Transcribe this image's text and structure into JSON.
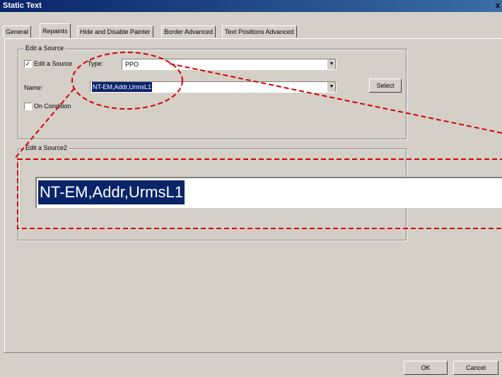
{
  "window": {
    "title": "Static Text",
    "close_glyph": "x"
  },
  "tabs": [
    {
      "label": "General",
      "active": false
    },
    {
      "label": "Repaints",
      "active": true
    },
    {
      "label": "Hide and Disable Painter",
      "active": false
    },
    {
      "label": "Border Advanced",
      "active": false
    },
    {
      "label": "Text Positions Advanced",
      "active": false
    }
  ],
  "group1": {
    "legend": "Edit a Source",
    "edit_checkbox": {
      "label": "Edit a Source",
      "checked": true,
      "mark": "✓"
    },
    "type_label": "Type:",
    "type_value": "PPO",
    "name_label": "Name:",
    "name_value": "NT-EM,Addr,UrmsL1",
    "select_button": "Select",
    "on_condition": {
      "label": "On Condition",
      "checked": false
    }
  },
  "group2": {
    "legend": "Edit a Source2",
    "zoom_value": "NT-EM,Addr,UrmsL1"
  },
  "footer": {
    "ok": "OK",
    "cancel": "Cancel"
  },
  "icons": {
    "dropdown": "dropdown-arrow-icon"
  },
  "colors": {
    "titlebar": "#0a246a",
    "selection": "#0a246a",
    "annotation": "#d40000",
    "face": "#d4d0c8"
  }
}
